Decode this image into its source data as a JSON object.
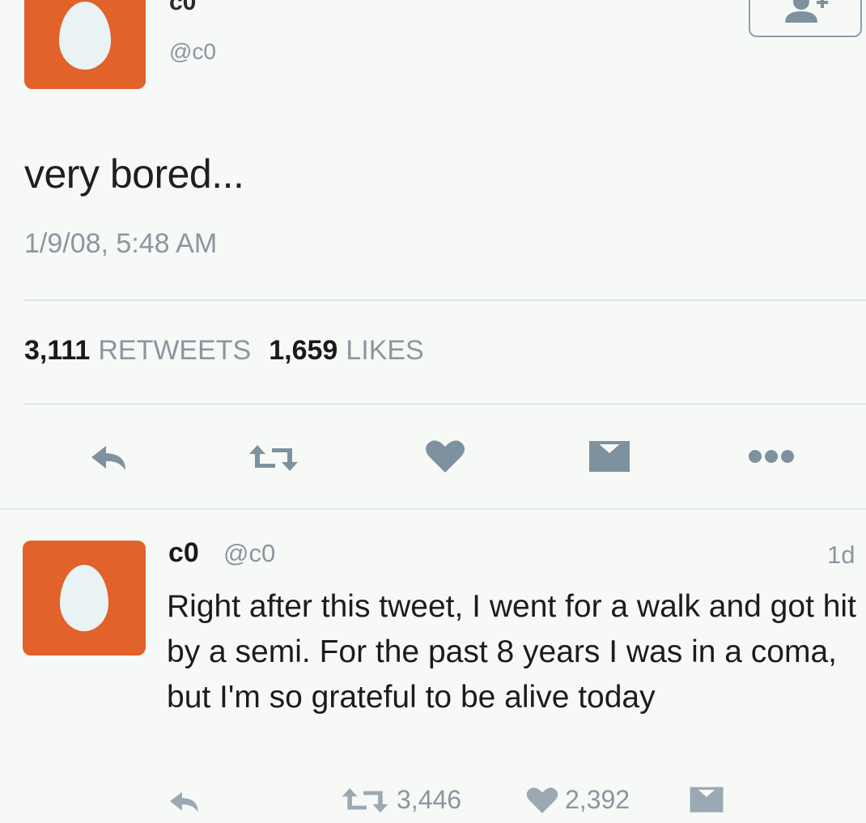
{
  "tweet": {
    "display_name": "c0",
    "handle": "@c0",
    "text": "very bored...",
    "timestamp": "1/9/08, 5:48 AM",
    "retweets_count": "3,111",
    "retweets_label": "RETWEETS",
    "likes_count": "1,659",
    "likes_label": "LIKES",
    "actions": [
      "reply-icon",
      "retweet-icon",
      "heart-icon",
      "message-icon",
      "more-icon"
    ]
  },
  "follow_button": {
    "icon": "follow-user-icon"
  },
  "reply": {
    "display_name": "c0",
    "handle": "@c0",
    "time": "1d",
    "text": "Right after this tweet, I went for a walk and got hit by a semi. For the past 8 years I was in a coma, but I'm so grateful to be alive today",
    "retweets_count": "3,446",
    "likes_count": "2,392",
    "actions": [
      "reply-icon",
      "retweet-icon",
      "heart-icon",
      "message-icon"
    ]
  },
  "colors": {
    "avatar": "#e1622a",
    "egg": "#e9f3f3",
    "icon": "#7e919e",
    "muted_text": "#8b96a0"
  }
}
